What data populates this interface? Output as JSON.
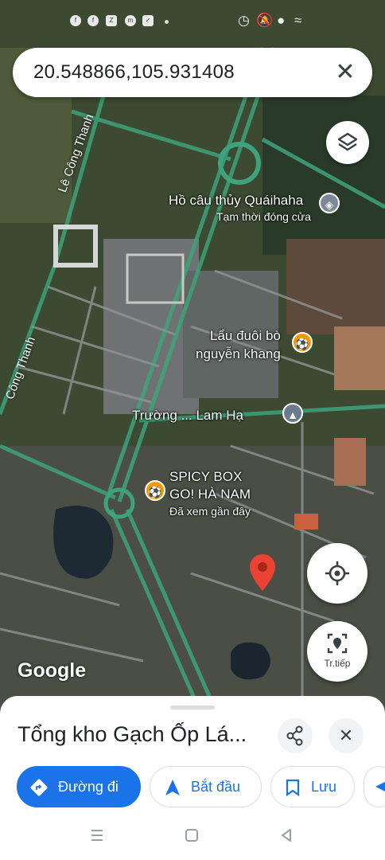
{
  "search": {
    "value": "20.548866,105.931408",
    "clear_icon": "close-icon"
  },
  "map": {
    "roads": [
      "Lê Công Thanh",
      "Công Thanh"
    ],
    "places": [
      {
        "name": "Hồ câu thủy Quáihaha",
        "subtitle": "Tạm thời đóng cửa",
        "icon": "fishing-icon",
        "color": "#7b8b96"
      },
      {
        "name_line1": "Lẩu đuôi bò",
        "name_line2": "nguyễn khang",
        "icon": "restaurant-icon",
        "color": "#f29900"
      },
      {
        "name": "Trường ... Lam Hạ",
        "icon": "school-icon",
        "color": "#6b7b8c"
      },
      {
        "name_line1": "SPICY BOX",
        "name_line2": "GO! HÀ NAM",
        "subtitle": "Đã xem gần đây",
        "icon": "restaurant-icon",
        "color": "#f29900"
      }
    ],
    "google_logo": "Google",
    "live_view_label": "Tr.tiếp",
    "marker_color": "#ea4335"
  },
  "sheet": {
    "title": "Tổng kho Gạch Ốp Lá...",
    "actions": [
      {
        "label": "Đường đi",
        "icon": "directions-icon"
      },
      {
        "label": "Bắt đầu",
        "icon": "navigation-arrow-icon"
      },
      {
        "label": "Lưu",
        "icon": "bookmark-icon"
      }
    ]
  },
  "colors": {
    "accent": "#1a73e8"
  }
}
